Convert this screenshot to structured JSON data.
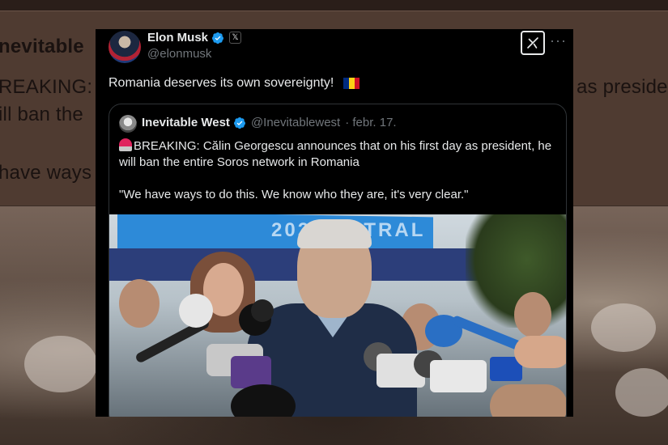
{
  "background_text": {
    "line1": "nevitable",
    "line2": "REAKING:",
    "line3": "ill ban the",
    "line4": "have ways",
    "line2_right": "as preside"
  },
  "tweet": {
    "author_name": "Elon Musk",
    "author_handle": "@elonmusk",
    "text": "Romania deserves its own sovereignty!",
    "flag_colors": [
      "#002B7F",
      "#FCD116",
      "#CE1126"
    ]
  },
  "quoted_tweet": {
    "author_name": "Inevitable West",
    "author_handle": "@Inevitablewest",
    "date": "· febr. 17.",
    "paragraph1": "BREAKING: Călin Georgescu announces that on his first day as president, he will ban the entire Soros network in Romania",
    "paragraph2": "\"We have ways to do this. We know who they are, it's very clear.\"",
    "photo_banner_text": "2024 ENTRAL"
  },
  "colors": {
    "verified_blue": "#1d9bf0",
    "card_bg": "#000000",
    "muted_text": "#71767b"
  },
  "icons": {
    "verified": "verified-badge-icon",
    "x_logo": "x-logo-icon",
    "grok": "grok-icon",
    "more": "more-icon",
    "siren": "siren-icon"
  }
}
